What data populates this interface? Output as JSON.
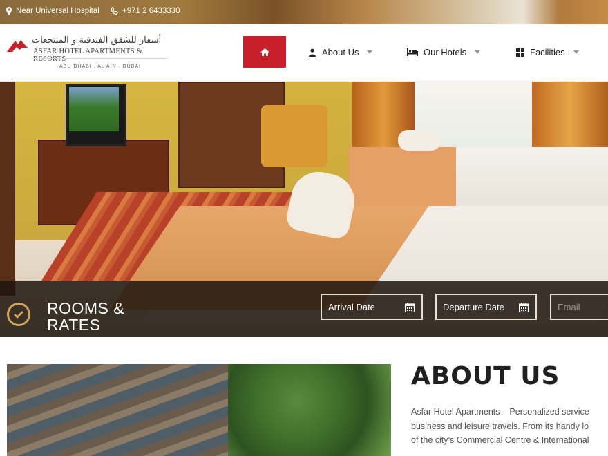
{
  "topbar": {
    "location": "Near Universal Hospital",
    "phone": "+971 2 6433330"
  },
  "logo": {
    "arabic": "أسفار للشقق الفندقية و المنتجعات",
    "english": "ASFAR HOTEL APARTMENTS & RESORTS",
    "cities": "ABU DHABI . AL AIN . DUBAI"
  },
  "nav": {
    "home_icon": "home-icon",
    "items": [
      {
        "label": "About Us",
        "icon": "user-icon"
      },
      {
        "label": "Our Hotels",
        "icon": "bed-icon"
      },
      {
        "label": "Facilities",
        "icon": "grid-icon"
      }
    ]
  },
  "booking": {
    "title_line1": "ROOMS &",
    "title_line2": "RATES",
    "arrival_placeholder": "Arrival Date",
    "departure_placeholder": "Departure Date",
    "email_placeholder": "Email"
  },
  "about": {
    "title": "ABOUT US",
    "lines": [
      "Asfar Hotel Apartments – Personalized service",
      "business and leisure travels. From its handy lo",
      "of the city’s Commercial Centre & International"
    ]
  },
  "colors": {
    "accent_red": "#c8202b",
    "gold": "#d2a45a"
  }
}
